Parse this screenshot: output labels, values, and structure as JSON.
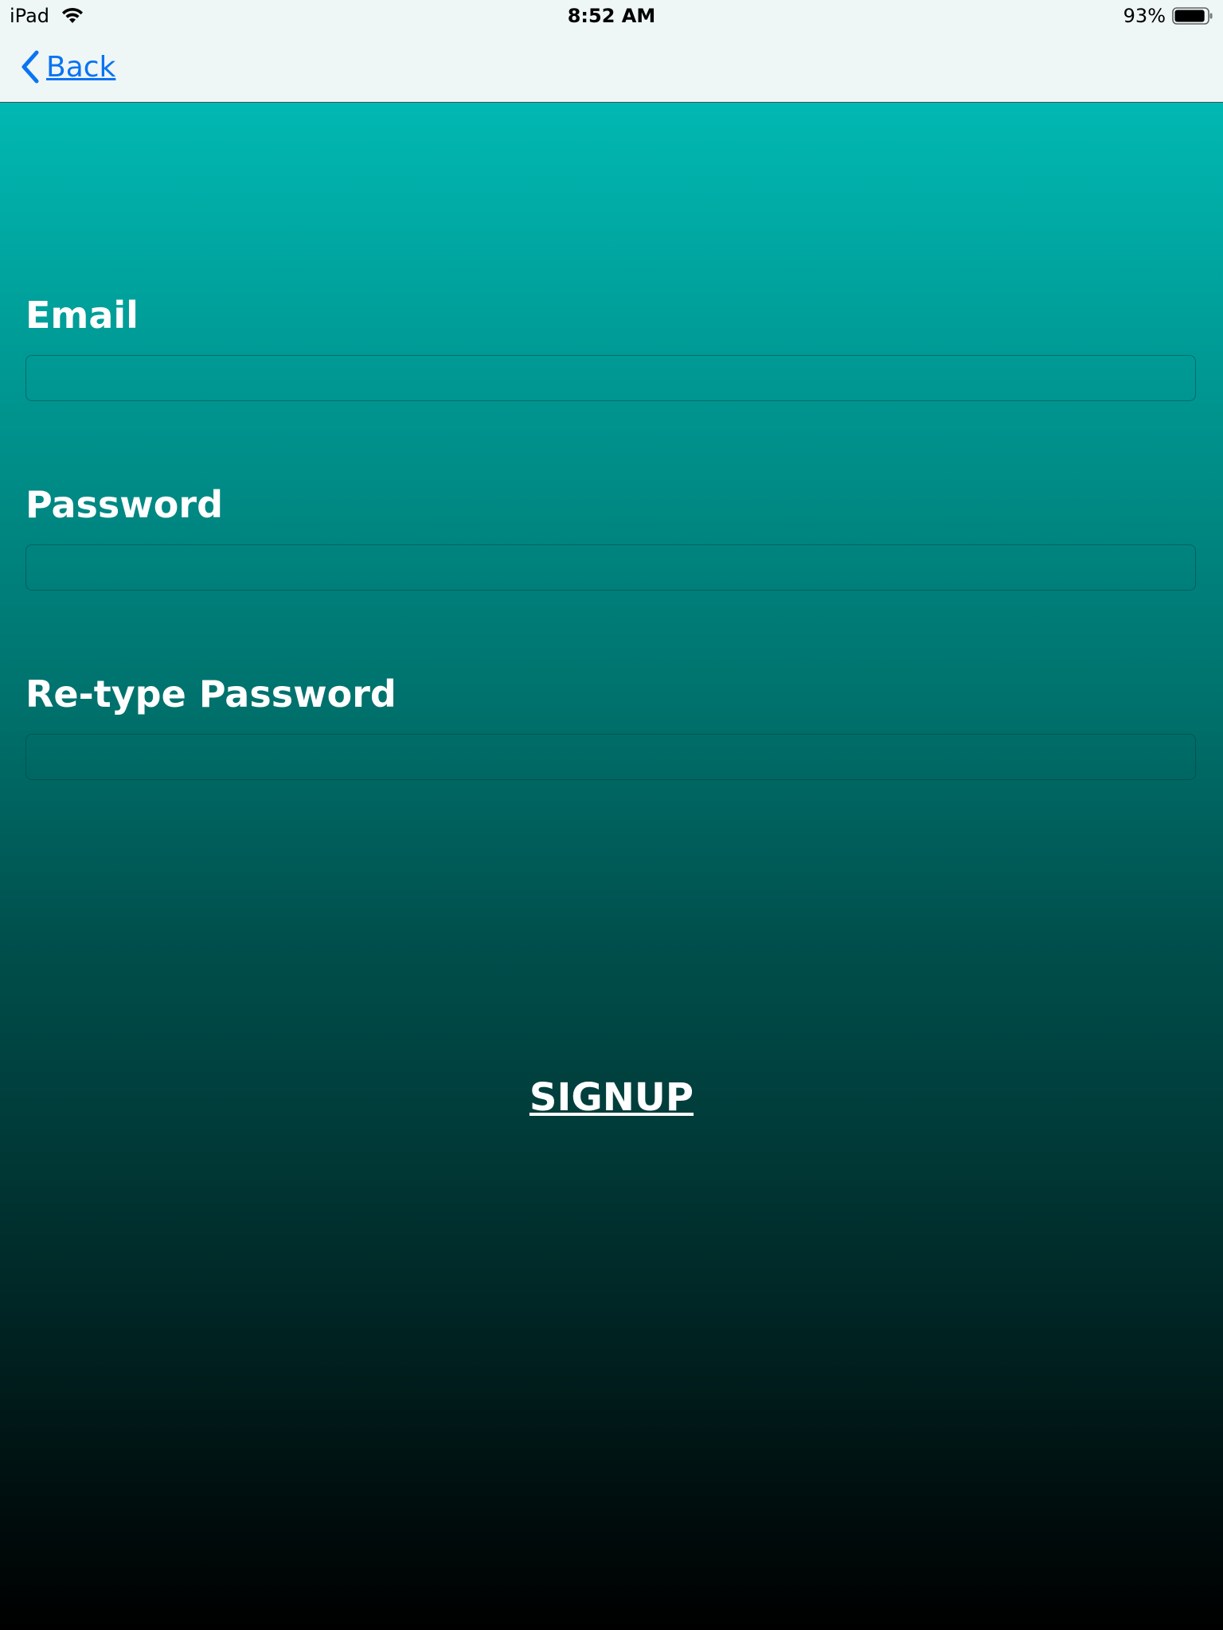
{
  "status_bar": {
    "device": "iPad",
    "time": "8:52 AM",
    "battery_percent": "93%",
    "battery_level": 0.93,
    "wifi_icon": "wifi-icon",
    "battery_icon": "battery-icon"
  },
  "nav": {
    "back_label": "Back",
    "back_icon": "chevron-left-icon",
    "accent_color": "#0a74f2"
  },
  "form": {
    "email_label": "Email",
    "email_value": "",
    "password_label": "Password",
    "password_value": "",
    "retype_label": "Re-type Password",
    "retype_value": "",
    "signup_label": "SIGNUP"
  },
  "colors": {
    "gradient_top": "#01b8b2",
    "gradient_bottom": "#000000",
    "text": "#ffffff"
  }
}
